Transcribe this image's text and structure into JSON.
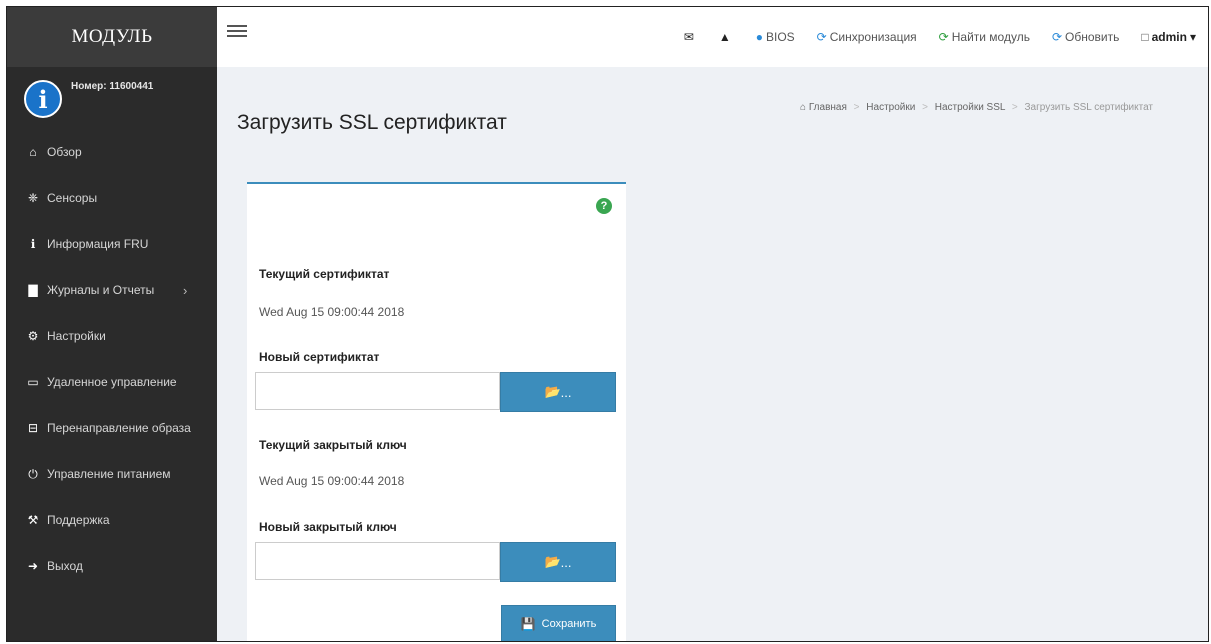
{
  "brand": "МОДУЛЬ",
  "user_panel": {
    "serial": "Номер: 11600441",
    "icon": "info-icon"
  },
  "sidebar": {
    "items": [
      {
        "label": "Обзор",
        "icon": "home-icon",
        "glyph": "⌂"
      },
      {
        "label": "Сенсоры",
        "icon": "sensors-icon",
        "glyph": "❈"
      },
      {
        "label": "Информация FRU",
        "icon": "info-circle-icon",
        "glyph": "ℹ"
      },
      {
        "label": "Журналы и Отчеты",
        "icon": "bar-chart-icon",
        "glyph": "▇",
        "caret": "›"
      },
      {
        "label": "Настройки",
        "icon": "gear-icon",
        "glyph": "⚙"
      },
      {
        "label": "Удаленное управление",
        "icon": "monitor-icon",
        "glyph": "▭"
      },
      {
        "label": "Перенаправление образа",
        "icon": "disk-drive-icon",
        "glyph": "⊟"
      },
      {
        "label": "Управление питанием",
        "icon": "power-icon",
        "glyph": "⏻"
      },
      {
        "label": "Поддержка",
        "icon": "wrench-icon",
        "glyph": "⚒"
      },
      {
        "label": "Выход",
        "icon": "sign-out-icon",
        "glyph": "➜"
      }
    ]
  },
  "topbar": {
    "bios": "BIOS",
    "sync": "Синхронизация",
    "find_module": "Найти модуль",
    "refresh": "Обновить",
    "user": "admin",
    "user_caret": "▾"
  },
  "page": {
    "title": "Загрузить SSL сертификтат",
    "breadcrumb": [
      "Главная",
      "Настройки",
      "Настройки SSL",
      "Загрузить SSL сертификтат"
    ]
  },
  "form": {
    "current_cert_label": "Текущий сертификтат",
    "current_cert_value": "Wed Aug 15 09:00:44 2018",
    "new_cert_label": "Новый сертификтат",
    "new_cert_value": "",
    "current_key_label": "Текущий закрытый ключ",
    "current_key_value": "Wed Aug 15 09:00:44 2018",
    "new_key_label": "Новый закрытый ключ",
    "new_key_value": "",
    "browse_suffix": "...",
    "save_label": "Сохранить"
  },
  "colors": {
    "sidebar_bg": "#2b2b2b",
    "brand_bg": "#3b3b3b",
    "primary": "#3c8dbc",
    "help": "#3aa651",
    "content_bg": "#eef1f5"
  }
}
